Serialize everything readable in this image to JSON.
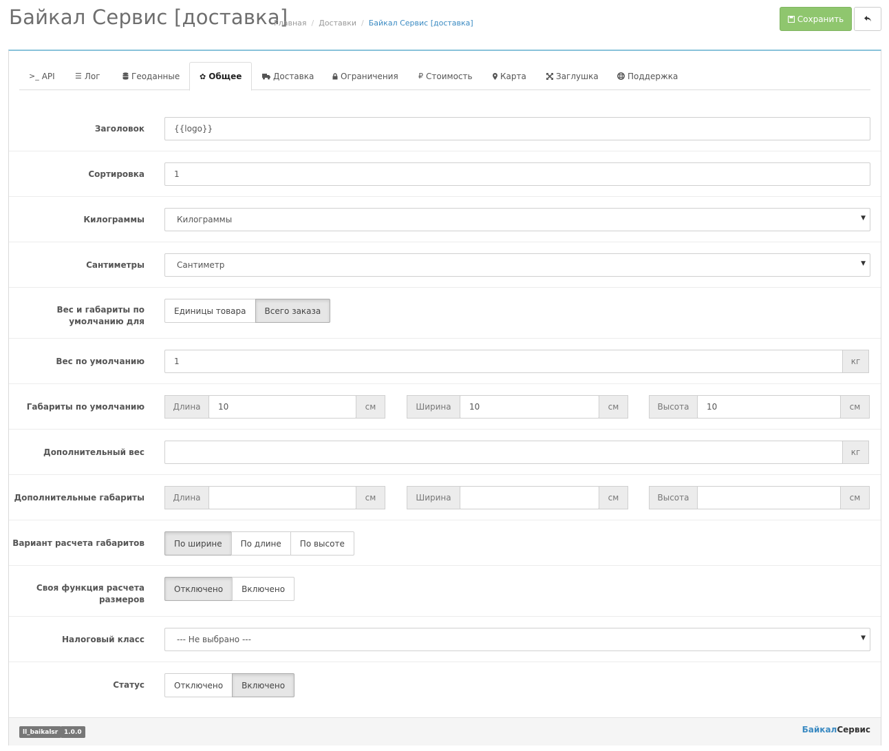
{
  "header": {
    "title": "Байкал Сервис [доставка]",
    "breadcrumb": [
      "Главная",
      "Доставки",
      "Байкал Сервис [доставка]"
    ],
    "save_label": "Сохранить",
    "accent_save": "#8fc66e"
  },
  "tabs": [
    {
      "label": "API",
      "icon": "terminal-icon"
    },
    {
      "label": "Лог",
      "icon": "list-icon"
    },
    {
      "label": "Геоданные",
      "icon": "database-icon"
    },
    {
      "label": "Общее",
      "icon": "gear-icon",
      "active": true
    },
    {
      "label": "Доставка",
      "icon": "truck-icon"
    },
    {
      "label": "Ограничения",
      "icon": "lock-icon"
    },
    {
      "label": "Стоимость",
      "icon": "ruble-icon"
    },
    {
      "label": "Карта",
      "icon": "map-marker-icon"
    },
    {
      "label": "Заглушка",
      "icon": "arrows-icon"
    },
    {
      "label": "Поддержка",
      "icon": "lifebuoy-icon"
    }
  ],
  "form": {
    "title_label": "Заголовок",
    "title_value": "{{logo}}",
    "sort_label": "Сортировка",
    "sort_value": "1",
    "kg_label": "Килограммы",
    "kg_value": "Килограммы",
    "cm_label": "Сантиметры",
    "cm_value": "Сантиметр",
    "default_for_label": "Вес и габариты по умолчанию для",
    "default_for_options": [
      "Единицы товара",
      "Всего заказа"
    ],
    "default_for_selected": "Всего заказа",
    "default_weight_label": "Вес по умолчанию",
    "default_weight_value": "1",
    "unit_kg": "кг",
    "unit_cm": "см",
    "default_dims_label": "Габариты по умолчанию",
    "length_label": "Длина",
    "width_label": "Ширина",
    "height_label": "Высота",
    "default_length": "10",
    "default_width": "10",
    "default_height": "10",
    "extra_weight_label": "Дополнительный вес",
    "extra_weight_value": "",
    "extra_dims_label": "Дополнительные габариты",
    "extra_length": "",
    "extra_width": "",
    "extra_height": "",
    "calc_variant_label": "Вариант расчета габаритов",
    "calc_variant_options": [
      "По ширине",
      "По длине",
      "По высоте"
    ],
    "calc_variant_selected": "По ширине",
    "custom_func_label": "Своя функция расчета размеров",
    "custom_func_options": [
      "Отключено",
      "Включено"
    ],
    "custom_func_selected": "Отключено",
    "tax_label": "Налоговый класс",
    "tax_value": " --- Не выбрано --- ",
    "status_label": "Статус",
    "status_options": [
      "Отключено",
      "Включено"
    ],
    "status_selected": "Включено"
  },
  "footer": {
    "module_code": "ll_baikalsr",
    "version": "1.0.0",
    "brand_part1": "Байкал",
    "brand_part2": "Сервис"
  }
}
